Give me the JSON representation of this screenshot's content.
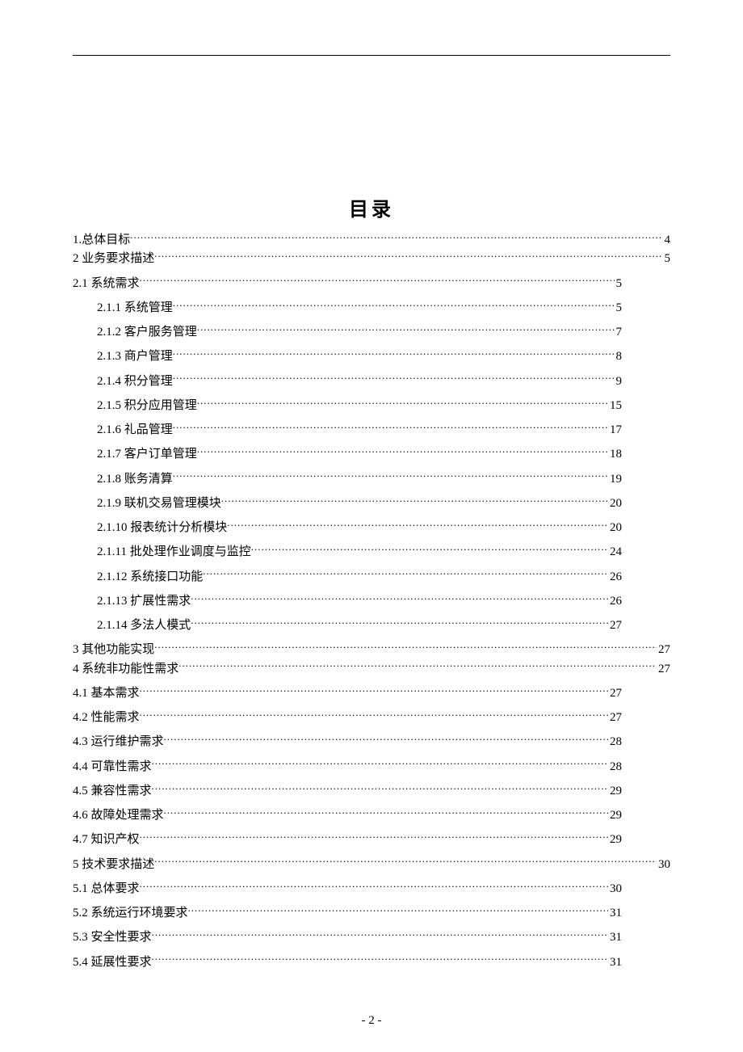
{
  "title": "目录",
  "page_number": "- 2 -",
  "entries": [
    {
      "label": "1.总体目标",
      "page": "4",
      "indent": 0,
      "width": "wide",
      "spacing": "tight"
    },
    {
      "label": "2 业务要求描述",
      "page": "5",
      "indent": 0,
      "width": "wide",
      "spacing": "tight"
    },
    {
      "label": "2.1 系统需求",
      "page": "5",
      "indent": 1,
      "width": "narrow",
      "spacing": "spaced"
    },
    {
      "label": "2.1.1 系统管理",
      "page": "5",
      "indent": 2,
      "width": "narrow",
      "spacing": "spaced"
    },
    {
      "label": "2.1.2 客户服务管理",
      "page": "7",
      "indent": 2,
      "width": "narrow",
      "spacing": "spaced"
    },
    {
      "label": "2.1.3 商户管理",
      "page": "8",
      "indent": 2,
      "width": "narrow",
      "spacing": "spaced"
    },
    {
      "label": "2.1.4 积分管理",
      "page": "9",
      "indent": 2,
      "width": "narrow",
      "spacing": "spaced"
    },
    {
      "label": "2.1.5 积分应用管理",
      "page": "15",
      "indent": 2,
      "width": "narrow",
      "spacing": "spaced"
    },
    {
      "label": "2.1.6 礼品管理",
      "page": "17",
      "indent": 2,
      "width": "narrow",
      "spacing": "spaced"
    },
    {
      "label": "2.1.7 客户订单管理",
      "page": "18",
      "indent": 2,
      "width": "narrow",
      "spacing": "spaced"
    },
    {
      "label": "2.1.8 账务清算",
      "page": "19",
      "indent": 2,
      "width": "narrow",
      "spacing": "spaced"
    },
    {
      "label": "2.1.9 联机交易管理模块",
      "page": "20",
      "indent": 2,
      "width": "narrow",
      "spacing": "spaced"
    },
    {
      "label": "2.1.10 报表统计分析模块",
      "page": "20",
      "indent": 2,
      "width": "narrow",
      "spacing": "spaced"
    },
    {
      "label": "2.1.11 批处理作业调度与监控",
      "page": "24",
      "indent": 2,
      "width": "narrow",
      "spacing": "spaced"
    },
    {
      "label": "2.1.12 系统接口功能",
      "page": "26",
      "indent": 2,
      "width": "narrow",
      "spacing": "spaced"
    },
    {
      "label": "2.1.13 扩展性需求",
      "page": "26",
      "indent": 2,
      "width": "narrow",
      "spacing": "spaced"
    },
    {
      "label": "2.1.14  多法人模式",
      "page": "27",
      "indent": 2,
      "width": "narrow",
      "spacing": "spaced"
    },
    {
      "label": "3 其他功能实现",
      "page": "27",
      "indent": 0,
      "width": "wide",
      "spacing": "tight"
    },
    {
      "label": "4 系统非功能性需求",
      "page": "27",
      "indent": 0,
      "width": "wide",
      "spacing": "tight"
    },
    {
      "label": "4.1 基本需求",
      "page": "27",
      "indent": 1,
      "width": "narrow",
      "spacing": "spaced"
    },
    {
      "label": "4.2 性能需求",
      "page": "27",
      "indent": 1,
      "width": "narrow",
      "spacing": "spaced"
    },
    {
      "label": "4.3 运行维护需求",
      "page": "28",
      "indent": 1,
      "width": "narrow",
      "spacing": "spaced"
    },
    {
      "label": "4.4 可靠性需求",
      "page": "28",
      "indent": 1,
      "width": "narrow",
      "spacing": "spaced"
    },
    {
      "label": "4.5 兼容性需求",
      "page": "29",
      "indent": 1,
      "width": "narrow",
      "spacing": "spaced"
    },
    {
      "label": "4.6 故障处理需求",
      "page": "29",
      "indent": 1,
      "width": "narrow",
      "spacing": "spaced"
    },
    {
      "label": "4.7 知识产权",
      "page": "29",
      "indent": 1,
      "width": "narrow",
      "spacing": "spaced"
    },
    {
      "label": "5 技术要求描述",
      "page": "30",
      "indent": 0,
      "width": "wide",
      "spacing": "tight"
    },
    {
      "label": "5.1 总体要求",
      "page": "30",
      "indent": 1,
      "width": "narrow",
      "spacing": "spaced"
    },
    {
      "label": "5.2 系统运行环境要求",
      "page": "31",
      "indent": 1,
      "width": "narrow",
      "spacing": "spaced"
    },
    {
      "label": "5.3 安全性要求",
      "page": "31",
      "indent": 1,
      "width": "narrow",
      "spacing": "spaced"
    },
    {
      "label": "5.4  延展性要求",
      "page": "31",
      "indent": 1,
      "width": "narrow",
      "spacing": "spaced"
    }
  ]
}
